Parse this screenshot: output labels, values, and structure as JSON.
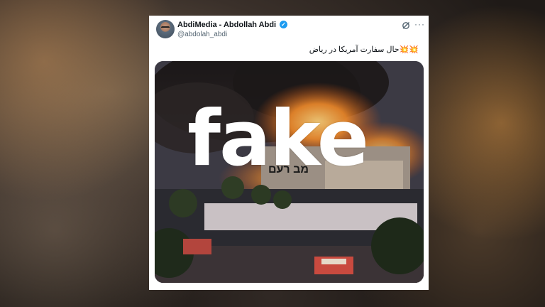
{
  "tweet": {
    "author_name": "AbdiMedia - Abdollah Abdi",
    "handle": "@abdolah_abdi",
    "text": "💥💥حال سفارت آمریکا در ریاض",
    "verified": true
  },
  "icons": {
    "verified": "verified-badge-icon",
    "grok": "grok-icon",
    "more": "more-options-icon"
  },
  "media": {
    "overlay_label": "fake",
    "sign_text": "מב רעם"
  },
  "colors": {
    "verified_blue": "#1d9bf0",
    "text_primary": "#0f1419",
    "text_secondary": "#536471"
  }
}
